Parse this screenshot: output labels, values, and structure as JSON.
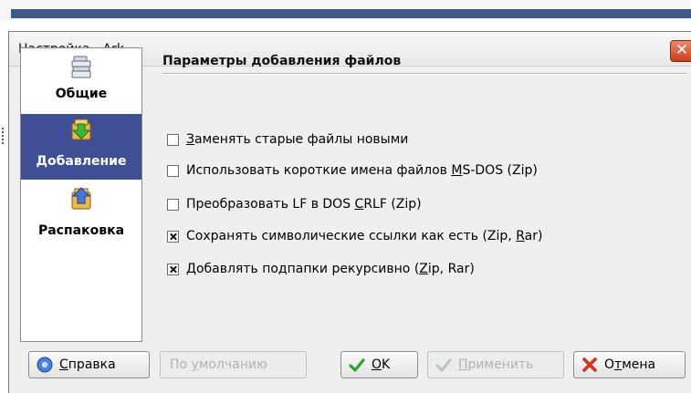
{
  "window": {
    "title": "Настройка - Ark",
    "close_glyph": "✕"
  },
  "sidebar": {
    "items": [
      {
        "label": "Общие",
        "icon": "general-settings-icon",
        "active": false
      },
      {
        "label": "Добавление",
        "icon": "add-files-icon",
        "active": true
      },
      {
        "label": "Распаковка",
        "icon": "extract-icon",
        "active": false
      }
    ]
  },
  "page": {
    "title": "Параметры добавления файлов",
    "options": [
      {
        "pre": "",
        "accel": "З",
        "post": "аменять старые файлы новыми",
        "checked": false
      },
      {
        "pre": "Использовать короткие имена файлов ",
        "accel": "M",
        "post": "S-DOS (Zip)",
        "checked": false
      },
      {
        "pre": "Преобразовать LF в DOS ",
        "accel": "C",
        "post": "RLF (Zip)",
        "checked": false
      },
      {
        "pre": "Сохранять символические ссылки как есть (Zip, ",
        "accel": "R",
        "post": "ar)",
        "checked": true
      },
      {
        "pre": "Добавлять подпапки рекурсивно (",
        "accel": "Z",
        "post": "ip, Rar)",
        "checked": true
      }
    ]
  },
  "buttons": {
    "help": {
      "pre": "",
      "accel": "С",
      "post": "правка",
      "icon": "help-icon"
    },
    "defaults": {
      "pre": "По ",
      "accel": "у",
      "post": "молчанию",
      "disabled": true
    },
    "ok": {
      "pre": "",
      "accel": "O",
      "post": "K",
      "icon": "checkmark-icon"
    },
    "apply": {
      "pre": "",
      "accel": "П",
      "post": "рименить",
      "icon": "checkmark-icon",
      "disabled": true
    },
    "cancel": {
      "pre": "О",
      "accel": "т",
      "post": "мена",
      "icon": "cancel-x-icon"
    }
  },
  "colors": {
    "accent": "#3f4f95",
    "close_button": "#c8401c",
    "ok_check": "#2fa12a",
    "cancel_x": "#d9321c"
  }
}
